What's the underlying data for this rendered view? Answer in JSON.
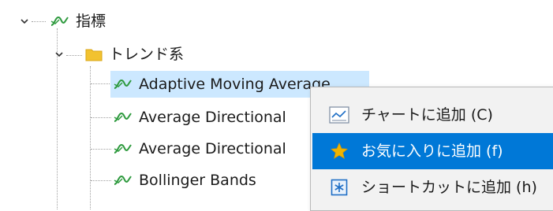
{
  "tree": {
    "root_label": "指標",
    "folder_label": "トレンド系",
    "items": [
      {
        "label": "Adaptive Moving Average"
      },
      {
        "label": "Average Directional"
      },
      {
        "label": "Average Directional"
      },
      {
        "label": "Bollinger Bands"
      }
    ]
  },
  "context_menu": {
    "items": [
      {
        "label": "チャートに追加 (C)",
        "icon": "chart-line-icon"
      },
      {
        "label": "お気に入りに追加 (f)",
        "icon": "star-icon"
      },
      {
        "label": "ショートカットに追加 (h)",
        "icon": "shortcut-key-icon"
      }
    ]
  },
  "colors": {
    "selection": "#cce8ff",
    "menu_highlight": "#0078d7",
    "indicator_icon": "#2e9a3e",
    "folder_icon": "#f2c230",
    "star_icon": "#f0b400",
    "shortcut_icon": "#1f6fc6"
  }
}
